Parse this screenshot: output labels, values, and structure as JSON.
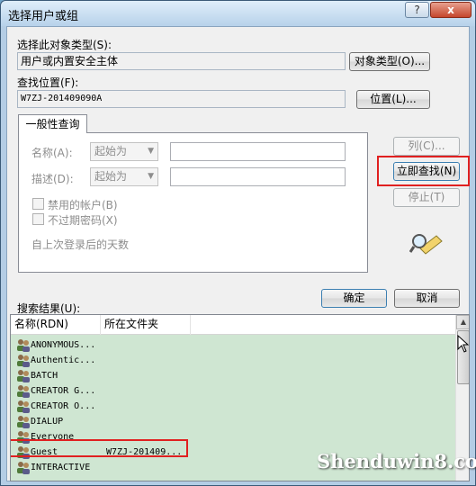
{
  "window": {
    "title": "选择用户或组",
    "help_label": "?",
    "close_label": "x"
  },
  "object_type": {
    "label": "选择此对象类型(S):",
    "value": "用户或内置安全主体",
    "button": "对象类型(O)..."
  },
  "location": {
    "label": "查找位置(F):",
    "value": "W7ZJ-201409090A",
    "button": "位置(L)..."
  },
  "query": {
    "tab_label": "一般性查询",
    "name_label": "名称(A):",
    "name_mode": "起始为",
    "desc_label": "描述(D):",
    "desc_mode": "起始为",
    "disabled_accounts": "禁用的帐户(B)",
    "no_expire_password": "不过期密码(X)",
    "days_since_login": "自上次登录后的天数"
  },
  "side_buttons": {
    "columns": "列(C)...",
    "find_now": "立即查找(N)",
    "stop": "停止(T)"
  },
  "ok_label": "确定",
  "cancel_label": "取消",
  "results": {
    "label": "搜索结果(U):",
    "columns": [
      "名称(RDN)",
      "所在文件夹"
    ],
    "rows": [
      {
        "name": "ANONYMOUS...",
        "folder": ""
      },
      {
        "name": "Authentic...",
        "folder": ""
      },
      {
        "name": "BATCH",
        "folder": ""
      },
      {
        "name": "CREATOR G...",
        "folder": ""
      },
      {
        "name": "CREATOR O...",
        "folder": ""
      },
      {
        "name": "DIALUP",
        "folder": ""
      },
      {
        "name": "Everyone",
        "folder": ""
      },
      {
        "name": "Guest",
        "folder": "W7ZJ-201409..."
      },
      {
        "name": "INTERACTIVE",
        "folder": ""
      }
    ]
  },
  "watermark": "Shenduwin8.com",
  "colors": {
    "highlight": "#e02020",
    "results_bg": "#cfe6d2"
  }
}
